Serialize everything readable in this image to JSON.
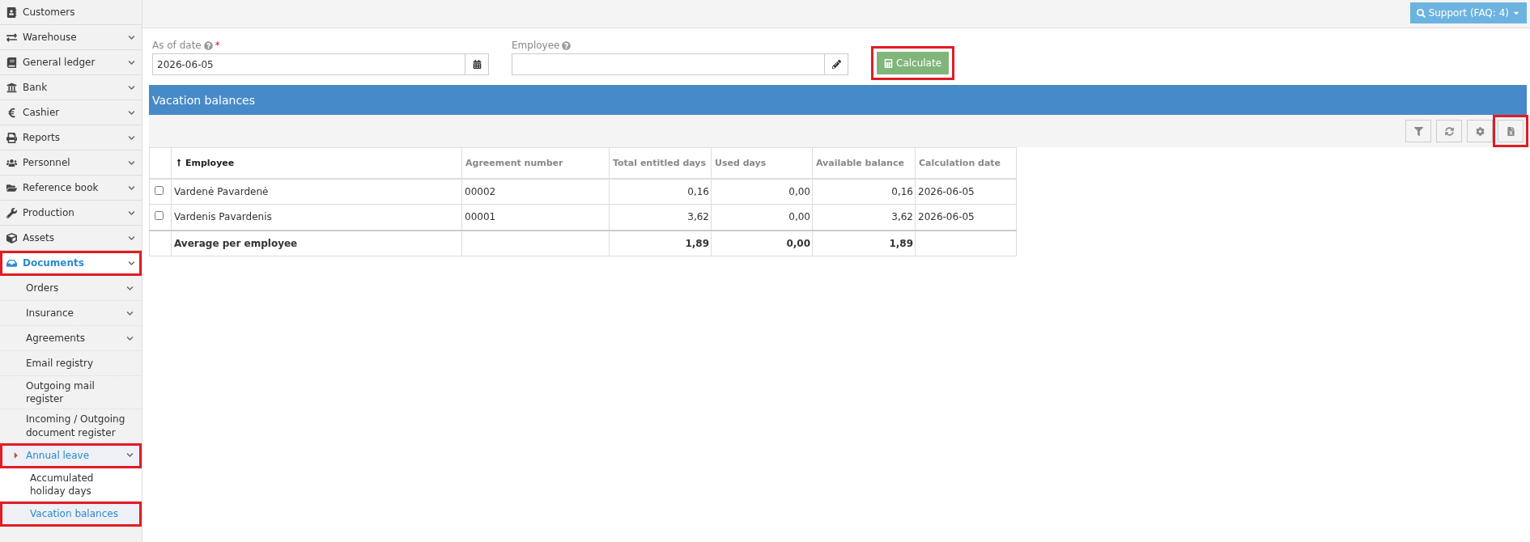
{
  "sidebar": {
    "items": [
      {
        "label": "Customers",
        "has_caret": false,
        "selected": false,
        "highlighted": false
      },
      {
        "label": "Warehouse",
        "has_caret": true,
        "selected": false,
        "highlighted": false
      },
      {
        "label": "General ledger",
        "has_caret": true,
        "selected": false,
        "highlighted": false
      },
      {
        "label": "Bank",
        "has_caret": true,
        "selected": false,
        "highlighted": false
      },
      {
        "label": "Cashier",
        "has_caret": true,
        "selected": false,
        "highlighted": false
      },
      {
        "label": "Reports",
        "has_caret": true,
        "selected": false,
        "highlighted": false
      },
      {
        "label": "Personnel",
        "has_caret": true,
        "selected": false,
        "highlighted": false
      },
      {
        "label": "Reference book",
        "has_caret": true,
        "selected": false,
        "highlighted": false
      },
      {
        "label": "Production",
        "has_caret": true,
        "selected": false,
        "highlighted": false
      },
      {
        "label": "Assets",
        "has_caret": true,
        "selected": false,
        "highlighted": false
      },
      {
        "label": "Documents",
        "has_caret": true,
        "selected": true,
        "highlighted": true,
        "children": [
          {
            "label": "Orders",
            "has_caret": true,
            "selected": false,
            "highlighted": false
          },
          {
            "label": "Insurance",
            "has_caret": true,
            "selected": false,
            "highlighted": false
          },
          {
            "label": "Agreements",
            "has_caret": true,
            "selected": false,
            "highlighted": false
          },
          {
            "label": "Email registry",
            "has_caret": false,
            "selected": false,
            "highlighted": false
          },
          {
            "label": "Outgoing mail register",
            "has_caret": false,
            "selected": false,
            "highlighted": false
          },
          {
            "label": "Incoming / Outgoing document register",
            "has_caret": false,
            "selected": false,
            "highlighted": false
          },
          {
            "label": "Annual leave",
            "has_caret": true,
            "selected": true,
            "highlighted": true,
            "children": [
              {
                "label": "Accumulated holiday days",
                "selected": false,
                "highlighted": false
              },
              {
                "label": "Vacation balances",
                "selected": true,
                "highlighted": true
              }
            ]
          }
        ]
      }
    ]
  },
  "support_button": {
    "label": "Support (FAQ: 4)"
  },
  "form": {
    "as_of_date": {
      "label": "As of date",
      "required_mark": "*",
      "value": "2026-06-05"
    },
    "employee": {
      "label": "Employee"
    },
    "calculate_button": {
      "label": "Calculate",
      "highlighted": true
    }
  },
  "panel": {
    "title": "Vacation balances",
    "toolbar": [
      {
        "highlighted": false
      },
      {
        "highlighted": false
      },
      {
        "highlighted": false
      },
      {
        "highlighted": true
      }
    ],
    "table": {
      "columns": [
        {
          "label": "Employee",
          "sorted": true,
          "bold": true
        },
        {
          "label": "Agreement number",
          "sorted": false,
          "bold": false
        },
        {
          "label": "Total entitled days",
          "sorted": false,
          "bold": false
        },
        {
          "label": "Used days",
          "sorted": false,
          "bold": false
        },
        {
          "label": "Available balance",
          "sorted": false,
          "bold": false
        },
        {
          "label": "Calculation date",
          "sorted": false,
          "bold": false
        }
      ],
      "rows": [
        {
          "checked": false,
          "cells": [
            "Vardenė Pavardenė",
            "00002",
            "0,16",
            "0,00",
            "0,16",
            "2026-06-05"
          ]
        },
        {
          "checked": false,
          "cells": [
            "Vardenis Pavardenis",
            "00001",
            "3,62",
            "0,00",
            "3,62",
            "2026-06-05"
          ]
        }
      ],
      "footer": {
        "cells": [
          "Average per employee",
          "",
          "1,89",
          "0,00",
          "1,89",
          ""
        ]
      }
    }
  }
}
